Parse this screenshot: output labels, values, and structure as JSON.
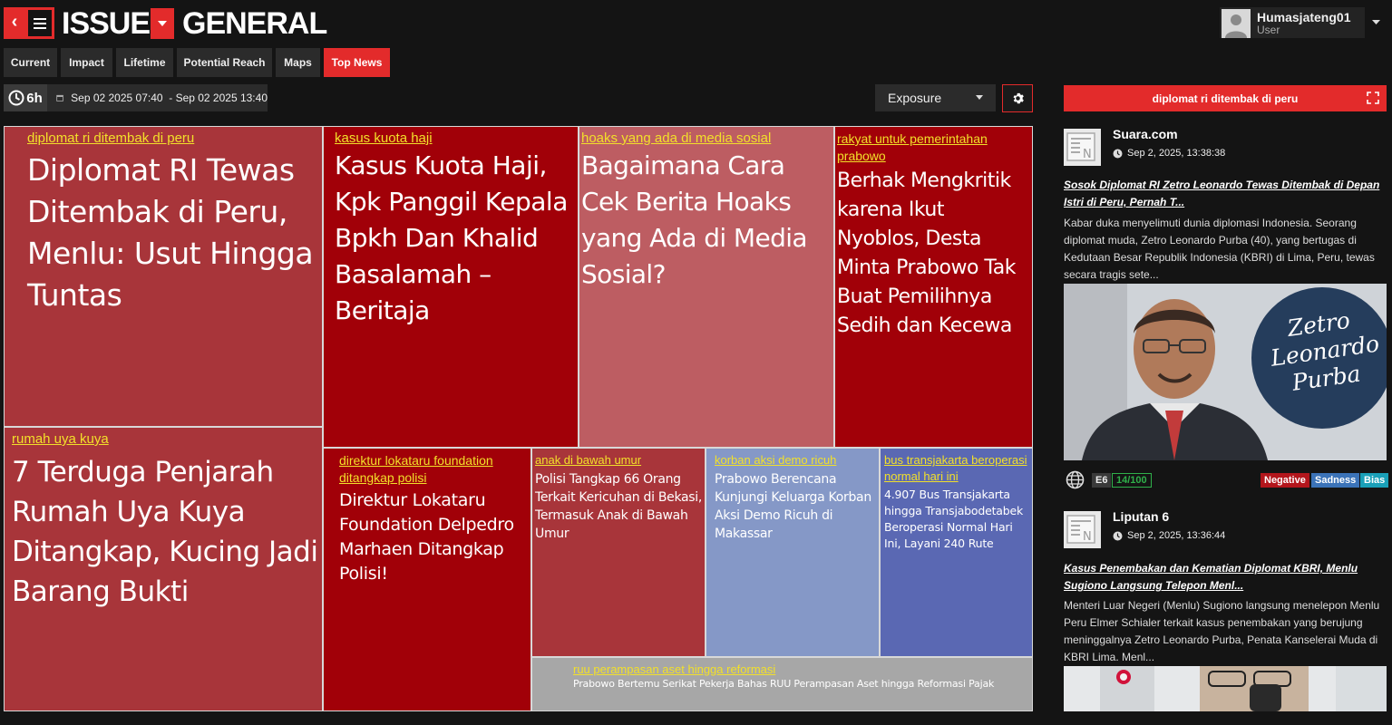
{
  "header": {
    "back_glyph": "‹",
    "title_left": "ISSUE",
    "title_right": "GENERAL"
  },
  "user": {
    "name": "Humasjateng01",
    "role": "User"
  },
  "tabs": [
    {
      "label": "Current",
      "active": false
    },
    {
      "label": "Impact",
      "active": false
    },
    {
      "label": "Lifetime",
      "active": false
    },
    {
      "label": "Potential Reach",
      "active": false
    },
    {
      "label": "Maps",
      "active": false
    },
    {
      "label": "Top News",
      "active": true
    }
  ],
  "filters": {
    "range_badge": "6h",
    "date_range": "Sep 02 2025 07:40  - Sep 02 2025 13:40",
    "metric_select": "Exposure"
  },
  "treemap": [
    {
      "category": "diplomat ri ditembak di peru",
      "headline": "Diplomat RI Tewas Ditembak di Peru, Menlu: Usut Hingga Tuntas",
      "color": "#a8353a"
    },
    {
      "category": "kasus kuota haji",
      "headline": "Kasus Kuota Haji, Kpk Panggil Kepala Bpkh Dan Khalid Basalamah – Beritaja",
      "color": "#a10008"
    },
    {
      "category": "hoaks yang ada di media sosial",
      "headline": "Bagaimana Cara Cek Berita Hoaks yang Ada di Media Sosial?",
      "color": "#bd5d62"
    },
    {
      "category": "rakyat untuk pemerintahan prabowo",
      "headline": "Berhak Mengkritik karena Ikut Nyoblos, Desta Minta Prabowo Tak Buat Pemilihnya Sedih dan Kecewa",
      "color": "#a10008"
    },
    {
      "category": "rumah uya kuya",
      "headline": "7 Terduga Penjarah Rumah Uya Kuya Ditangkap, Kucing Jadi Barang Bukti",
      "color": "#a8353a"
    },
    {
      "category": "direktur lokataru foundation ditangkap polisi",
      "headline": "Direktur Lokataru Foundation Delpedro Marhaen Ditangkap Polisi!",
      "color": "#a10008"
    },
    {
      "category": "anak di bawah umur",
      "headline": "Polisi Tangkap 66 Orang Terkait Kericuhan di Bekasi, Termasuk Anak di Bawah Umur",
      "color": "#a8353a"
    },
    {
      "category": "korban aksi demo ricuh",
      "headline": "Prabowo Berencana Kunjungi Keluarga Korban Aksi Demo Ricuh di Makassar",
      "color": "#8598c7"
    },
    {
      "category": "bus transjakarta beroperasi normal hari ini",
      "headline": "4.907 Bus Transjakarta hingga Transjabodetabek Beroperasi Normal Hari Ini, Layani 240 Rute",
      "color": "#5a68b3"
    },
    {
      "category": "ruu perampasan aset hingga reformasi",
      "headline": "Prabowo Bertemu Serikat Pekerja Bahas RUU Perampasan Aset hingga Reformasi Pajak",
      "color": "#a7a7a7"
    }
  ],
  "panel": {
    "topic": "diplomat ri ditembak di peru",
    "articles": [
      {
        "source": "Suara.com",
        "date": "Sep 2, 2025, 13:38:38",
        "title": "Sosok Diplomat RI Zetro Leonardo Tewas Ditembak di Depan Istri di Peru, Pernah T...",
        "body": "Kabar duka menyelimuti dunia diplomasi Indonesia. Seorang diplomat muda, Zetro Leonardo Purba (40), yang bertugas di Kedutaan Besar Republik Indonesia (KBRI) di Lima, Peru, tewas secara tragis sete...",
        "image_text": [
          "Zetro",
          "Leonardo",
          "Purba"
        ],
        "exposure_badge": "E6",
        "score": "14/100",
        "tags": [
          {
            "label": "Negative",
            "color": "#b3161c"
          },
          {
            "label": "Sadness",
            "color": "#3b73b8"
          },
          {
            "label": "Bias",
            "color": "#1aa0b8"
          }
        ]
      },
      {
        "source": "Liputan 6",
        "date": "Sep 2, 2025, 13:36:44",
        "title": "Kasus Penembakan dan Kematian Diplomat KBRI, Menlu Sugiono Langsung Telepon Menl...",
        "body": "Menteri Luar Negeri (Menlu) Sugiono langsung menelepon Menlu Peru Elmer Schialer terkait kasus penembakan yang berujung meninggalnya Zetro Leonardo Purba, Penata Kanselerai Muda di KBRI Lima. Menl..."
      }
    ]
  }
}
